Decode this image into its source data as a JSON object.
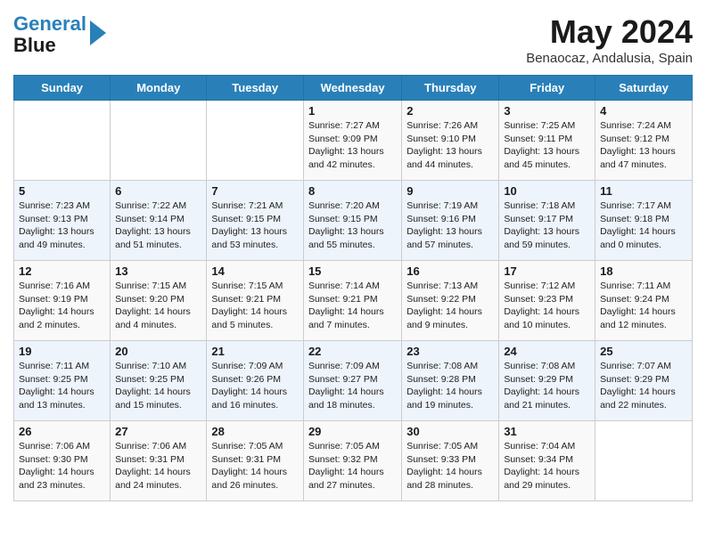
{
  "header": {
    "logo_line1": "General",
    "logo_line2": "Blue",
    "month": "May 2024",
    "location": "Benaocaz, Andalusia, Spain"
  },
  "days_of_week": [
    "Sunday",
    "Monday",
    "Tuesday",
    "Wednesday",
    "Thursday",
    "Friday",
    "Saturday"
  ],
  "weeks": [
    [
      {
        "day": "",
        "info": ""
      },
      {
        "day": "",
        "info": ""
      },
      {
        "day": "",
        "info": ""
      },
      {
        "day": "1",
        "info": "Sunrise: 7:27 AM\nSunset: 9:09 PM\nDaylight: 13 hours and 42 minutes."
      },
      {
        "day": "2",
        "info": "Sunrise: 7:26 AM\nSunset: 9:10 PM\nDaylight: 13 hours and 44 minutes."
      },
      {
        "day": "3",
        "info": "Sunrise: 7:25 AM\nSunset: 9:11 PM\nDaylight: 13 hours and 45 minutes."
      },
      {
        "day": "4",
        "info": "Sunrise: 7:24 AM\nSunset: 9:12 PM\nDaylight: 13 hours and 47 minutes."
      }
    ],
    [
      {
        "day": "5",
        "info": "Sunrise: 7:23 AM\nSunset: 9:13 PM\nDaylight: 13 hours and 49 minutes."
      },
      {
        "day": "6",
        "info": "Sunrise: 7:22 AM\nSunset: 9:14 PM\nDaylight: 13 hours and 51 minutes."
      },
      {
        "day": "7",
        "info": "Sunrise: 7:21 AM\nSunset: 9:15 PM\nDaylight: 13 hours and 53 minutes."
      },
      {
        "day": "8",
        "info": "Sunrise: 7:20 AM\nSunset: 9:15 PM\nDaylight: 13 hours and 55 minutes."
      },
      {
        "day": "9",
        "info": "Sunrise: 7:19 AM\nSunset: 9:16 PM\nDaylight: 13 hours and 57 minutes."
      },
      {
        "day": "10",
        "info": "Sunrise: 7:18 AM\nSunset: 9:17 PM\nDaylight: 13 hours and 59 minutes."
      },
      {
        "day": "11",
        "info": "Sunrise: 7:17 AM\nSunset: 9:18 PM\nDaylight: 14 hours and 0 minutes."
      }
    ],
    [
      {
        "day": "12",
        "info": "Sunrise: 7:16 AM\nSunset: 9:19 PM\nDaylight: 14 hours and 2 minutes."
      },
      {
        "day": "13",
        "info": "Sunrise: 7:15 AM\nSunset: 9:20 PM\nDaylight: 14 hours and 4 minutes."
      },
      {
        "day": "14",
        "info": "Sunrise: 7:15 AM\nSunset: 9:21 PM\nDaylight: 14 hours and 5 minutes."
      },
      {
        "day": "15",
        "info": "Sunrise: 7:14 AM\nSunset: 9:21 PM\nDaylight: 14 hours and 7 minutes."
      },
      {
        "day": "16",
        "info": "Sunrise: 7:13 AM\nSunset: 9:22 PM\nDaylight: 14 hours and 9 minutes."
      },
      {
        "day": "17",
        "info": "Sunrise: 7:12 AM\nSunset: 9:23 PM\nDaylight: 14 hours and 10 minutes."
      },
      {
        "day": "18",
        "info": "Sunrise: 7:11 AM\nSunset: 9:24 PM\nDaylight: 14 hours and 12 minutes."
      }
    ],
    [
      {
        "day": "19",
        "info": "Sunrise: 7:11 AM\nSunset: 9:25 PM\nDaylight: 14 hours and 13 minutes."
      },
      {
        "day": "20",
        "info": "Sunrise: 7:10 AM\nSunset: 9:25 PM\nDaylight: 14 hours and 15 minutes."
      },
      {
        "day": "21",
        "info": "Sunrise: 7:09 AM\nSunset: 9:26 PM\nDaylight: 14 hours and 16 minutes."
      },
      {
        "day": "22",
        "info": "Sunrise: 7:09 AM\nSunset: 9:27 PM\nDaylight: 14 hours and 18 minutes."
      },
      {
        "day": "23",
        "info": "Sunrise: 7:08 AM\nSunset: 9:28 PM\nDaylight: 14 hours and 19 minutes."
      },
      {
        "day": "24",
        "info": "Sunrise: 7:08 AM\nSunset: 9:29 PM\nDaylight: 14 hours and 21 minutes."
      },
      {
        "day": "25",
        "info": "Sunrise: 7:07 AM\nSunset: 9:29 PM\nDaylight: 14 hours and 22 minutes."
      }
    ],
    [
      {
        "day": "26",
        "info": "Sunrise: 7:06 AM\nSunset: 9:30 PM\nDaylight: 14 hours and 23 minutes."
      },
      {
        "day": "27",
        "info": "Sunrise: 7:06 AM\nSunset: 9:31 PM\nDaylight: 14 hours and 24 minutes."
      },
      {
        "day": "28",
        "info": "Sunrise: 7:05 AM\nSunset: 9:31 PM\nDaylight: 14 hours and 26 minutes."
      },
      {
        "day": "29",
        "info": "Sunrise: 7:05 AM\nSunset: 9:32 PM\nDaylight: 14 hours and 27 minutes."
      },
      {
        "day": "30",
        "info": "Sunrise: 7:05 AM\nSunset: 9:33 PM\nDaylight: 14 hours and 28 minutes."
      },
      {
        "day": "31",
        "info": "Sunrise: 7:04 AM\nSunset: 9:34 PM\nDaylight: 14 hours and 29 minutes."
      },
      {
        "day": "",
        "info": ""
      }
    ]
  ]
}
